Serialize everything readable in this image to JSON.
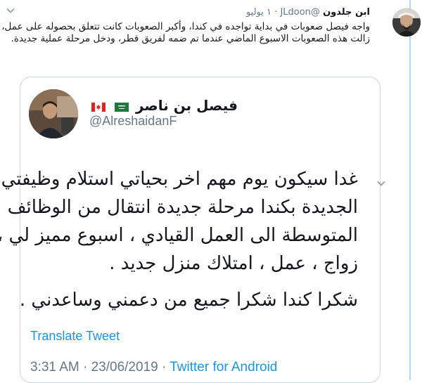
{
  "outer_tweet": {
    "author_name": "ابن جلدون",
    "handle": "@JLdoon",
    "separator": "·",
    "date": "١ يوليو",
    "text": "واجه فيصل صعوبات في بداية تواجده في كندا، وأكبر الصعوبات كانت تتعلق بحصوله على عمل، زالت هذه الصعوبات الاسبوع الماضي عندما تم ضمه لفريق قطر، ودخل مرحلة عملية جديدة."
  },
  "quoted_tweet": {
    "author_name": "فيصل بن ناصر",
    "handle": "@AlreshaidanF",
    "lines": [
      "غدا سيكون يوم مهم اخر بحياتي استلام وظيفتي",
      "الجديدة بكندا مرحلة جديدة انتقال من الوظائف",
      "المتوسطة الى العمل القيادي ، اسبوع مميز لي ،",
      "زواج ، عمل ، امتلاك منزل جديد .",
      "شكرا كندا شكرا جميع من دعمني وساعدني ."
    ],
    "translate_label": "Translate Tweet",
    "time": "3:31 AM",
    "dot": "·",
    "date": "23/06/2019",
    "source": "Twitter for Android"
  },
  "icons": {
    "outer_menu": "chevron-down-icon",
    "quoted_menu": "chevron-down-icon",
    "flags": [
      "canada-flag-icon",
      "saudi-flag-icon"
    ]
  },
  "colors": {
    "link": "#1b95e0",
    "muted": "#657786",
    "border": "#ccd6dd",
    "thread_rail": "#b3d7f1"
  }
}
